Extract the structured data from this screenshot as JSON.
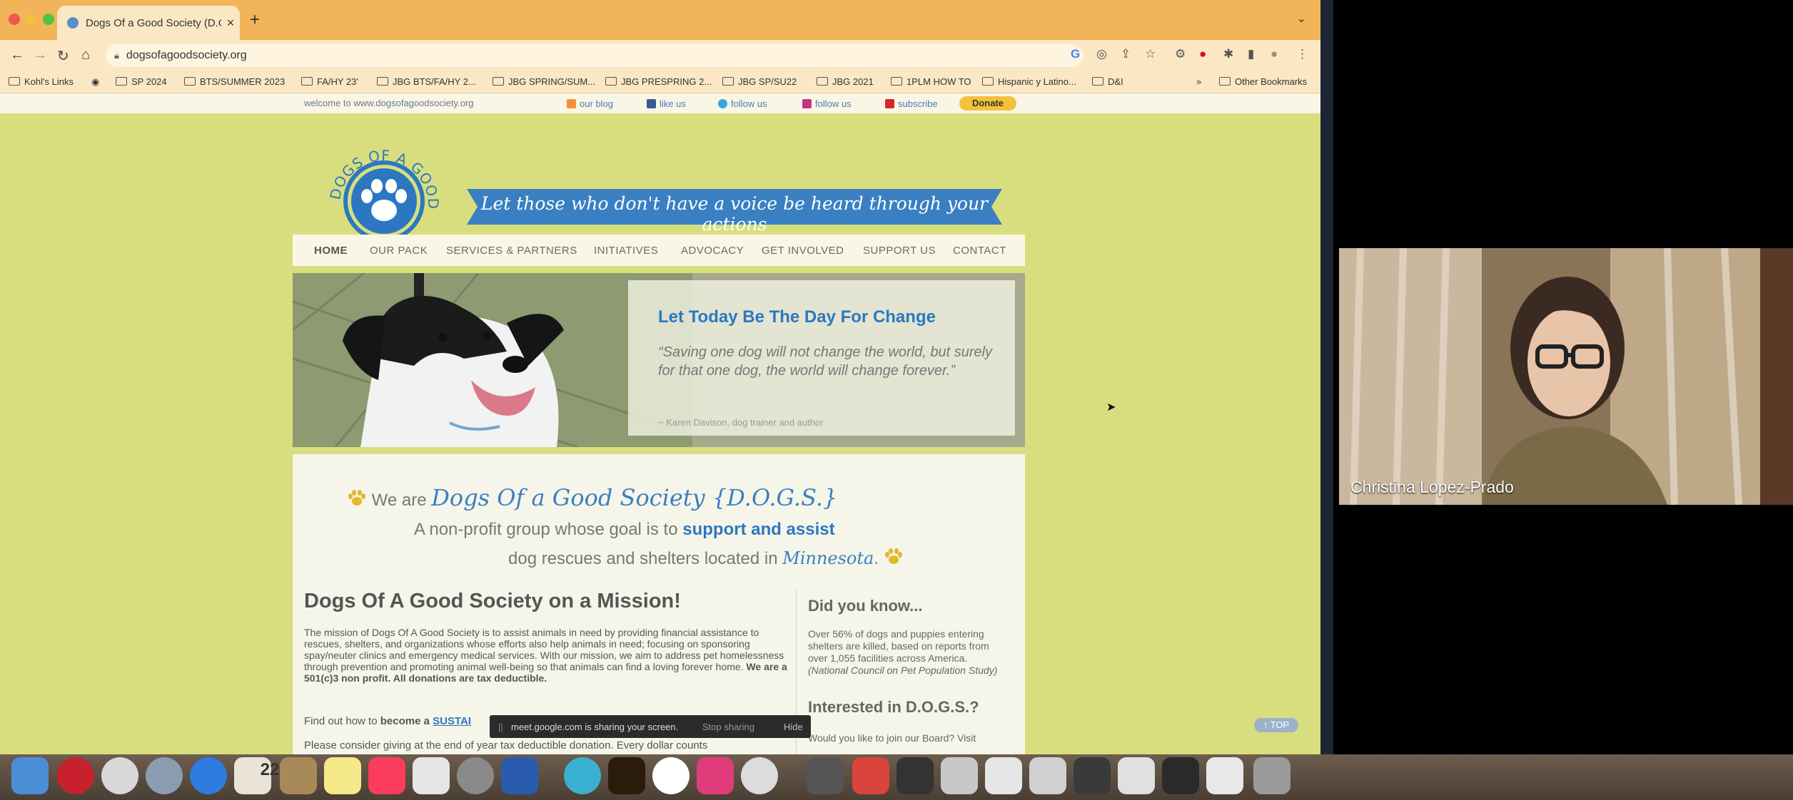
{
  "browser": {
    "tab_title": "Dogs Of a Good Society (D.O.G",
    "tab_close": "×",
    "new_tab": "+",
    "url": "dogsofagoodsociety.org",
    "bookmarks": [
      "Kohl's Links",
      "SP 2024",
      "BTS/SUMMER 2023",
      "FA/HY 23'",
      "JBG BTS/FA/HY 2...",
      "JBG SPRING/SUM...",
      "JBG PRESPRING 2...",
      "JBG SP/SU22",
      "JBG 2021",
      "1PLM HOW TO",
      "Hispanic y Latino...",
      "D&I"
    ],
    "bookmarks_more": "»",
    "other_bookmarks": "Other Bookmarks"
  },
  "site": {
    "welcome": "welcome to www.dogsofagoodsociety.org",
    "social": [
      "our blog",
      "like us",
      "follow us",
      "follow us",
      "subscribe"
    ],
    "social_colors": [
      "#f0913a",
      "#3b5998",
      "#3aa3e3",
      "#c13584",
      "#d62828"
    ],
    "donate": "Donate",
    "logo_text": "DOGS OF A GOOD SOCIETY",
    "tagline": "Let those who don't have a voice be heard through your actions",
    "nav": [
      "HOME",
      "OUR PACK",
      "SERVICES & PARTNERS",
      "INITIATIVES",
      "ADVOCACY",
      "GET INVOLVED",
      "SUPPORT US",
      "CONTACT"
    ],
    "hero": {
      "title": "Let Today Be The Day For Change",
      "quote": "“Saving one dog will not change the world, but surely for that one dog, the world will change forever.”",
      "author": "~ Karen Davison, dog trainer and author"
    },
    "intro": {
      "we_are": "We are",
      "brand": "Dogs Of a Good Society {D.O.G.S.}",
      "line2_pre": "A non-profit group whose goal is to",
      "line2_bold": "support and assist",
      "line3_pre": "dog rescues and shelters located in",
      "line3_state": "Minnesota",
      "line3_post": "."
    },
    "mission": {
      "heading": "Dogs Of A Good Society on a Mission!",
      "body": "The mission of Dogs Of A Good Society is to assist animals in need by providing financial assistance to rescues, shelters, and organizations whose efforts also help animals in need; focusing on sponsoring spay/neuter clinics and emergency medical services.  With our mission, we aim to address pet homelessness through prevention and promoting animal well-being so that animals can find a loving forever home.",
      "body_bold": "We are a 501(c)3 non profit. All donations are tax deductible.",
      "cta_pre": "Find out how to",
      "cta_bold": "become a",
      "cta_link": "SUSTAI",
      "more": "Please consider giving at the end of year tax deductible donation. Every dollar counts"
    },
    "didyouknow": {
      "heading": "Did you know...",
      "body": "Over 56% of dogs and puppies entering shelters are killed, based on reports from over 1,055 facilities across America.",
      "source": "(National Council on Pet Population Study)"
    },
    "interested": {
      "heading": "Interested in D.O.G.S.?",
      "body": "Would you like to join our Board? Visit"
    },
    "to_top": "↑ TOP"
  },
  "share_notice": {
    "handle": "||",
    "text": "meet.google.com is sharing your screen.",
    "stop": "Stop sharing",
    "hide": "Hide"
  },
  "video": {
    "participant": "Christina Lopez-Prado"
  },
  "dock": {
    "calendar_day": "22",
    "icon_colors": [
      "#4a8fd6",
      "#c8202c",
      "#d8d8d8",
      "#8a9db0",
      "#2f7be0",
      "#e9e3d8",
      "#a88a58",
      "#f6e98a",
      "#fc3c5c",
      "#e6e6e6",
      "#8a8a8a",
      "#2a5cae",
      "#3ab0d0",
      "#2b1b0b",
      "#ffffff",
      "#e13c7a",
      "#dcdcdc",
      "#555555",
      "#d9443c",
      "#333333",
      "#c8c8c8"
    ]
  }
}
